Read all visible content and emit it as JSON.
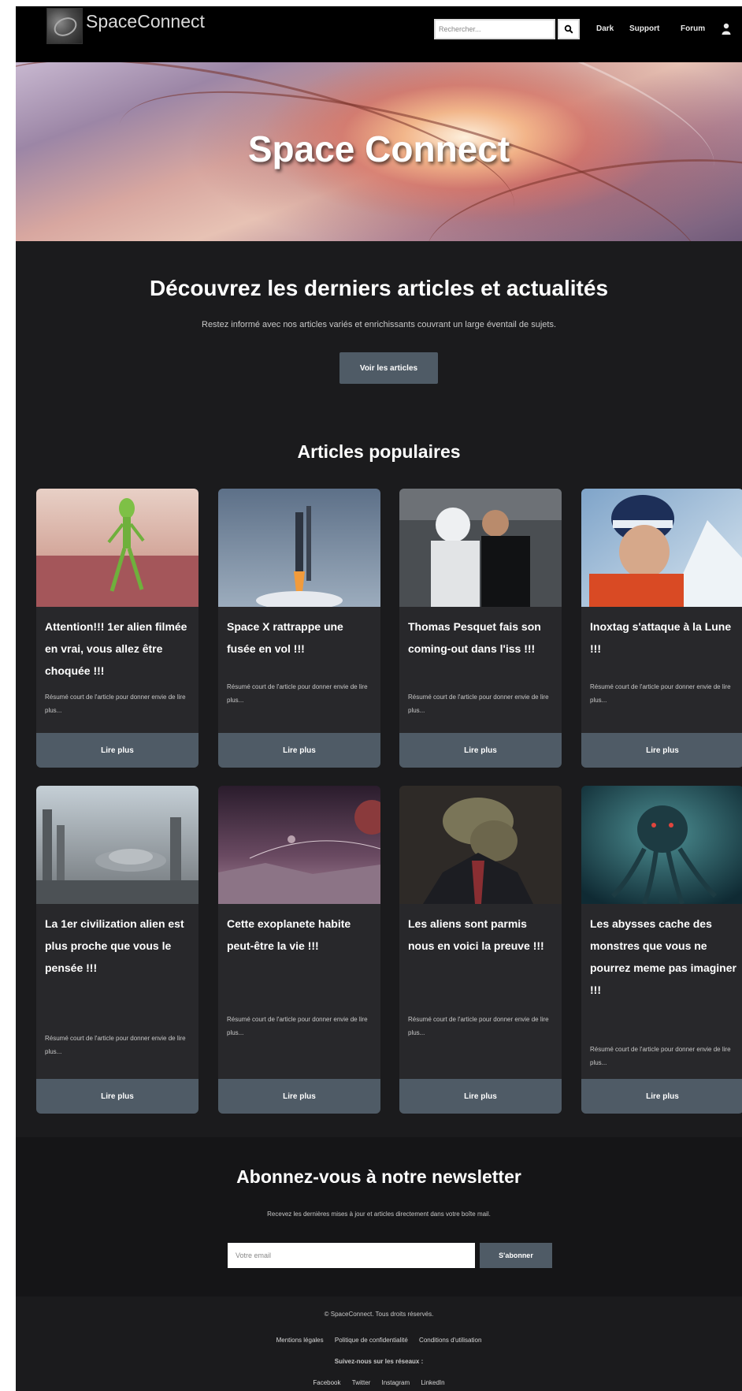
{
  "header": {
    "logo_text": "SpaceConnect",
    "search_placeholder": "Rechercher...",
    "nav": [
      "Dark",
      "Support",
      "Forum"
    ]
  },
  "hero": {
    "title": "Space Connect"
  },
  "intro": {
    "title": "Découvrez les derniers articles et actualités",
    "subtitle": "Restez informé avec nos articles variés et enrichissants couvrant un large éventail de sujets.",
    "button": "Voir les articles"
  },
  "popular": {
    "title": "Articles populaires",
    "read_more": "Lire plus",
    "excerpt": "Résumé court de l'article pour donner envie de lire plus...",
    "articles": [
      {
        "title": "Attention!!! 1er alien filmée en vrai, vous allez être choquée !!!",
        "image": "green-alien"
      },
      {
        "title": "Space X rattrappe une fusée en vol !!!",
        "image": "rocket-launch"
      },
      {
        "title": "Thomas Pesquet fais son coming-out dans l'iss !!!",
        "image": "astronauts"
      },
      {
        "title": "Inoxtag s'attaque à la Lune !!!",
        "image": "climber"
      },
      {
        "title": "La 1er civilization alien est plus proche que vous le pensée !!!",
        "image": "alien-city"
      },
      {
        "title": "Cette exoplanete habite peut-être la vie !!!",
        "image": "exoplanet"
      },
      {
        "title": "Les aliens sont parmis nous en voici la preuve !!!",
        "image": "lizard-man"
      },
      {
        "title": "Les abysses cache des monstres que vous ne pourrez meme pas imaginer !!!",
        "image": "sea-monster"
      }
    ]
  },
  "newsletter": {
    "title": "Abonnez-vous à notre newsletter",
    "subtitle": "Recevez les dernières mises à jour et articles directement dans votre boîte mail.",
    "placeholder": "Votre email",
    "button": "S'abonner"
  },
  "footer": {
    "copyright": "© SpaceConnect. Tous droits réservés.",
    "links": [
      "Mentions légales",
      "Politique de confidentialité",
      "Conditions d'utilisation"
    ],
    "follow": "Suivez-nous sur les réseaux :",
    "social": [
      "Facebook",
      "Twitter",
      "Instagram",
      "LinkedIn"
    ]
  },
  "colors": {
    "page_bg": "#1b1b1d",
    "navbar_bg": "#000000",
    "card_bg": "#28282b",
    "button_bg": "#4f5b66",
    "newsletter_bg": "#151517"
  }
}
